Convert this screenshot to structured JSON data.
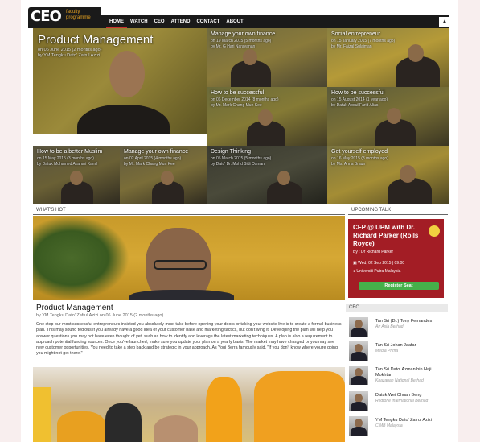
{
  "logo": {
    "text": "CEO",
    "sub": "faculty programme"
  },
  "nav": {
    "items": [
      "HOME",
      "WATCH",
      "CEO",
      "ATTEND",
      "CONTACT",
      "ABOUT"
    ],
    "user_icon": "user-icon"
  },
  "featured": {
    "title": "Product Management",
    "date": "on 06 June 2015 (2 months ago)",
    "author": "by YM Tengku Dato' Zafrul Azizi"
  },
  "tiles": [
    {
      "title": "Manage your own finance",
      "date": "on 19 March 2015 (5 months ago)",
      "author": "by Mr. G Hari Narayanan"
    },
    {
      "title": "Social entrepreneur",
      "date": "on 15 January 2015 (7 months ago)",
      "author": "by Mr. Faizal Sulaiman"
    },
    {
      "title": "How to be successful",
      "date": "on 06 December 2014 (8 months ago)",
      "author": "by Mr. Mark Chang Mun Kee"
    },
    {
      "title": "How to be successful",
      "date": "on 15 August 2014 (1 year ago)",
      "author": "by Datuk Abdul Farid Alias"
    },
    {
      "title": "How to be a better Muslim",
      "date": "on 15 May 2015 (3 months ago)",
      "author": "by Datuk Mohamed Azahari Kamil"
    },
    {
      "title": "Manage your own finance",
      "date": "on 02 April 2015 (4 months ago)",
      "author": "by Mr. Mark Chang Mun Kee"
    },
    {
      "title": "Design Thinking",
      "date": "on 05 March 2015 (5 months ago)",
      "author": "by Dato' Dr. Mohd Sidi Osman"
    },
    {
      "title": "Get yourself employed",
      "date": "on 16 May 2015 (3 months ago)",
      "author": "by Ms. Anna Braun"
    }
  ],
  "sections": {
    "whats_hot": "WHAT'S HOT",
    "upcoming": "UPCOMING TALK",
    "ceo": "CEO"
  },
  "article": {
    "title": "Product Management",
    "meta": "by YM Tengku Dato' Zafrul Azizi on 06 June 2015 (2 months ago)",
    "body": "One step our most successful entrepreneurs insisted you absolutely must take before opening your doors or taking your website live is to create a formal business plan. This may sound tedious if you already have a good idea of your customer base and marketing tactics, but don't wing it. Developing the plan will help you answer questions you may not have even thought of yet, such as how to identify and leverage the latest marketing techniques. A plan is also a requirement to approach potential funding sources. Once you've launched, make sure you update your plan on a yearly basis. The market may have changed or you may see new customer opportunities. You need to take a step back and be strategic in your approach. As Yogi Berra famously said, \"If you don't know where you're going, you might not get there.\""
  },
  "event": {
    "title": "CFP @ UPM with Dr. Richard Parker (Rolls Royce)",
    "by": "By : Dr Richard Parker",
    "date": "Wed, 02 Sep 2015 | 09:00",
    "venue": "Universiti Putra Malaysia",
    "button": "Register Seat"
  },
  "ceos": [
    {
      "name": "Tan Sri (Dr.) Tony Fernandes",
      "company": "Air Asia Berhad"
    },
    {
      "name": "Tan Sri Johan Jaafar",
      "company": "Media Prima"
    },
    {
      "name": "Tan Sri Dato' Azman bin Haji Mokhtar",
      "company": "Khazanah National Berhad"
    },
    {
      "name": "Datuk Wei Chuan Beng",
      "company": "Redtone International Berhad"
    },
    {
      "name": "YM Tengku Dato' Zafrul Azizi",
      "company": "CIMB Malaysia"
    }
  ],
  "colors": {
    "accent": "#a31d25",
    "register": "#46b04a",
    "logo_sub": "#e4a020"
  }
}
